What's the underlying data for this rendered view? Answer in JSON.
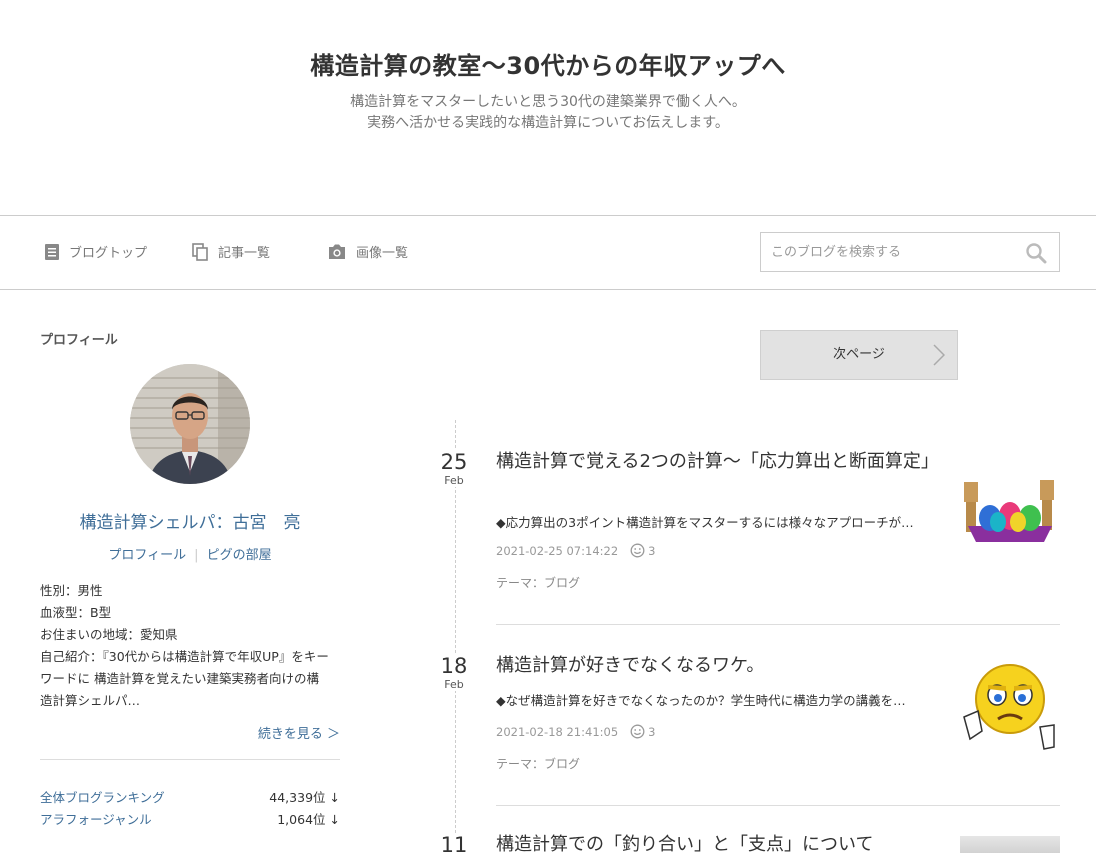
{
  "header": {
    "title": "構造計算の教室～30代からの年収アップへ",
    "desc_line1": "構造計算をマスターしたいと思う30代の建築業界で働く人へ。",
    "desc_line2": "実務へ活かせる実践的な構造計算についてお伝えします。"
  },
  "nav": {
    "top_label": "ブログトップ",
    "list_label": "記事一覧",
    "images_label": "画像一覧",
    "search_placeholder": "このブログを検索する"
  },
  "profile": {
    "heading": "プロフィール",
    "name": "構造計算シェルパ：古宮　亮",
    "link_profile": "プロフィール",
    "link_room": "ピグの部屋",
    "lines": [
      "性別：男性",
      "血液型：B型",
      "お住まいの地域：愛知県",
      "自己紹介：『30代からは構造計算で年収UP』をキー",
      "ワードに 構造計算を覚えたい建築実務者向けの構",
      "造計算シェルパ…"
    ],
    "read_more": "続きを見る ＞",
    "rankings": [
      {
        "name": "全体ブログランキング",
        "value": "44,339位",
        "arrow": "↓"
      },
      {
        "name": "アラフォージャンル",
        "value": "1,064位",
        "arrow": "↓"
      }
    ]
  },
  "pager": {
    "next_label": "次ページ"
  },
  "entries": [
    {
      "day": "25",
      "month": "Feb",
      "title": "構造計算で覚える2つの計算～「応力算出と断面算定」",
      "summary": "◆応力算出の3ポイント構造計算をマスターするには様々なアプローチが…",
      "datetime": "2021-02-25 07:14:22",
      "likes": "3",
      "theme": "テーマ：ブログ",
      "thumb_icon": "easter-eggs-figures"
    },
    {
      "day": "18",
      "month": "Feb",
      "title": "構造計算が好きでなくなるワケ。",
      "summary": "◆なぜ構造計算を好きでなくなったのか？学生時代に構造力学の講義を…",
      "datetime": "2021-02-18 21:41:05",
      "likes": "3",
      "theme": "テーマ：ブログ",
      "thumb_icon": "thumbs-down-emoji"
    },
    {
      "day": "11",
      "month": "",
      "title": "構造計算での「釣り合い」と「支点」について",
      "summary": "",
      "datetime": "",
      "likes": "",
      "theme": "",
      "thumb_icon": "gray-image"
    }
  ],
  "colors": {
    "link": "#3f6e98",
    "border": "#cccccc",
    "pager_bg": "#e2e2e2"
  }
}
